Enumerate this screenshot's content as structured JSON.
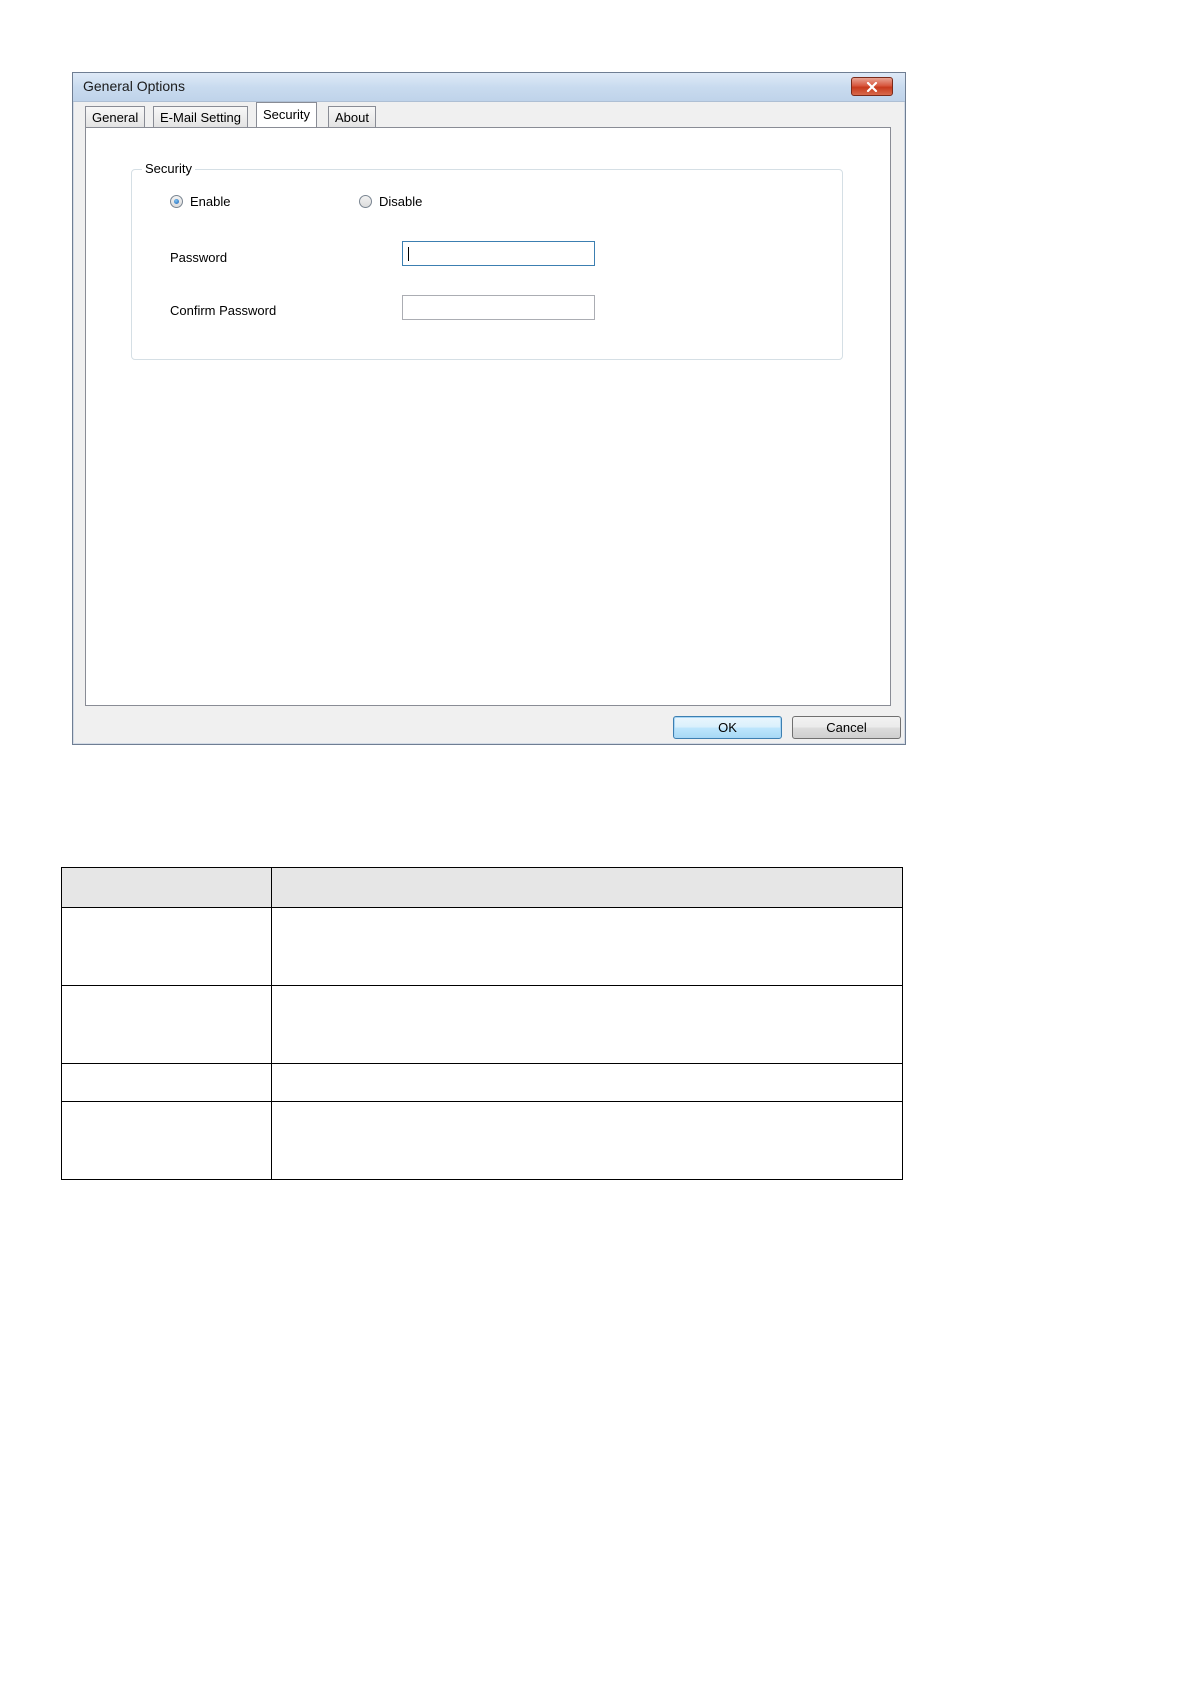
{
  "window": {
    "title": "General Options",
    "close_icon": "close-icon"
  },
  "tabs": [
    {
      "label": "General",
      "active": false
    },
    {
      "label": "E-Mail Setting",
      "active": false
    },
    {
      "label": "Security",
      "active": true
    },
    {
      "label": "About",
      "active": false
    }
  ],
  "security": {
    "group_label": "Security",
    "enable_label": "Enable",
    "disable_label": "Disable",
    "enable_selected": true,
    "password_label": "Password",
    "password_value": "",
    "confirm_label": "Confirm Password",
    "confirm_value": ""
  },
  "buttons": {
    "ok_label": "OK",
    "cancel_label": "Cancel"
  },
  "table": {
    "header": [
      "",
      ""
    ],
    "rows": [
      [
        "",
        ""
      ],
      [
        "",
        ""
      ],
      [
        "",
        ""
      ],
      [
        "",
        ""
      ]
    ]
  }
}
